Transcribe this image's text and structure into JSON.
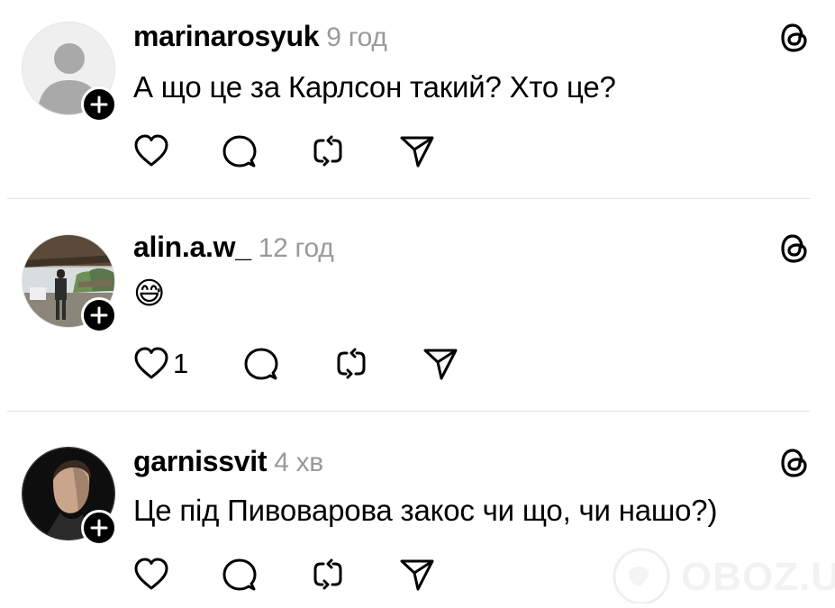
{
  "posts": [
    {
      "username": "marinarosyuk",
      "time": "9 год",
      "text": "А що це за Карлсон такий? Хто це?",
      "likes": ""
    },
    {
      "username": "alin.a.w_",
      "time": "12 год",
      "text": "😅",
      "likes": "1"
    },
    {
      "username": "garnissvit",
      "time": "4 хв",
      "text": "Це під Пивоварова закос чи що, чи нашо?)",
      "likes": ""
    }
  ],
  "icons": {
    "like": "heart-icon",
    "reply": "comment-icon",
    "repost": "repost-icon",
    "share": "send-icon",
    "app": "threads-icon",
    "follow": "plus-icon"
  },
  "watermark": {
    "text": "OBOZ.UA"
  }
}
